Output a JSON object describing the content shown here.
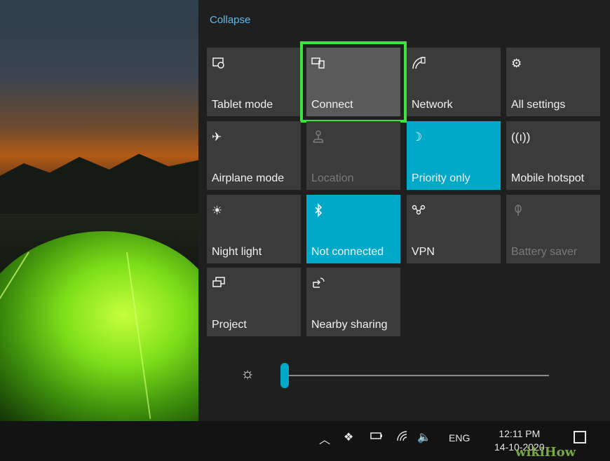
{
  "action_center": {
    "collapse_label": "Collapse",
    "tiles": [
      {
        "label": "Tablet mode",
        "icon": "tablet-mode-icon",
        "state": "off-normal"
      },
      {
        "label": "Connect",
        "icon": "connect-icon",
        "state": "highlighted"
      },
      {
        "label": "Network",
        "icon": "network-icon",
        "state": "normal"
      },
      {
        "label": "All settings",
        "icon": "gear-icon",
        "state": "normal"
      },
      {
        "label": "Airplane mode",
        "icon": "airplane-icon",
        "state": "normal"
      },
      {
        "label": "Location",
        "icon": "location-icon",
        "state": "disabled"
      },
      {
        "label": "Priority only",
        "icon": "moon-icon",
        "state": "on"
      },
      {
        "label": "Mobile hotspot",
        "icon": "hotspot-icon",
        "state": "normal"
      },
      {
        "label": "Night light",
        "icon": "night-light-icon",
        "state": "normal"
      },
      {
        "label": "Not connected",
        "icon": "bluetooth-icon",
        "state": "on"
      },
      {
        "label": "VPN",
        "icon": "vpn-icon",
        "state": "normal"
      },
      {
        "label": "Battery saver",
        "icon": "battery-saver-icon",
        "state": "disabled"
      },
      {
        "label": "Project",
        "icon": "project-icon",
        "state": "normal"
      },
      {
        "label": "Nearby sharing",
        "icon": "nearby-sharing-icon",
        "state": "normal"
      }
    ],
    "brightness": {
      "icon": "brightness-icon",
      "level": 0
    }
  },
  "taskbar": {
    "language": "ENG",
    "time": "12:11 PM",
    "date": "14-10-2020"
  },
  "watermark": "wikiHow",
  "colors": {
    "accent": "#00a9c7",
    "highlight": "#3fe33f",
    "tile": "#3b3b3b"
  }
}
